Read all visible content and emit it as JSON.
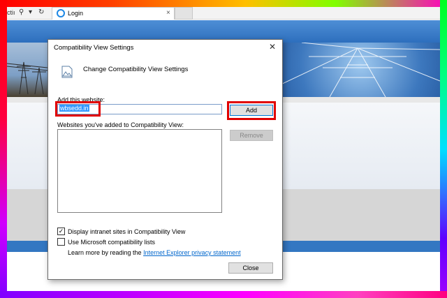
{
  "browser": {
    "address_fragment": "ctiı",
    "tab_title": "Login",
    "tab_close_glyph": "×",
    "search_glyph": "⚲",
    "dropdown_glyph": "▾",
    "refresh_glyph": "↻"
  },
  "dialog": {
    "title": "Compatibility View Settings",
    "close_glyph": "✕",
    "header": "Change Compatibility View Settings",
    "add_label": "Add this website:",
    "site_value": "wbsedd.in",
    "add_button": "Add",
    "list_label": "Websites you've added to Compatibility View:",
    "sites": [],
    "remove_button": "Remove",
    "options": [
      {
        "label": "Display intranet sites in Compatibility View",
        "checked": true
      },
      {
        "label": "Use Microsoft compatibility lists",
        "checked": false
      }
    ],
    "learn_prefix": "Learn more by reading the ",
    "learn_link": "Internet Explorer privacy statement",
    "close_button": "Close"
  },
  "colors": {
    "highlight": "#e00000",
    "link": "#0066cc",
    "selection": "#3399ff"
  }
}
